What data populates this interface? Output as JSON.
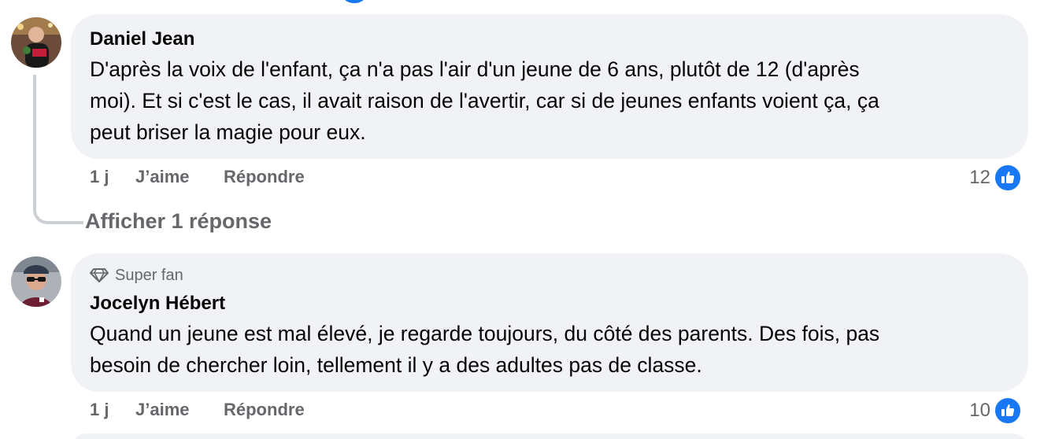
{
  "comments": [
    {
      "author": "Daniel Jean",
      "text": "D'après la voix de l'enfant, ça n'a pas l'air d'un jeune de 6 ans, plutôt de 12 (d'après\nmoi). Et si c'est le cas, il avait raison de l'avertir, car si de jeunes enfants voient ça, ça\npeut briser la magie pour eux.",
      "time": "1 j",
      "like_label": "J’aime",
      "reply_label": "Répondre",
      "reaction_count": "12",
      "show_replies_label": "Afficher 1 réponse"
    },
    {
      "badge_label": "Super fan",
      "author": "Jocelyn Hébert",
      "text": "Quand un jeune est mal élevé, je regarde toujours, du côté des parents. Des fois, pas\nbesoin de chercher loin, tellement il y a des adultes pas de classe.",
      "time": "1 j",
      "like_label": "J’aime",
      "reply_label": "Répondre",
      "reaction_count": "10"
    }
  ],
  "colors": {
    "bubble": "#f0f2f5",
    "secondary_text": "#65676b",
    "like_blue": "#1877f2"
  },
  "icons": {
    "badge": "diamond-icon",
    "reaction": "thumbs-up-icon"
  }
}
